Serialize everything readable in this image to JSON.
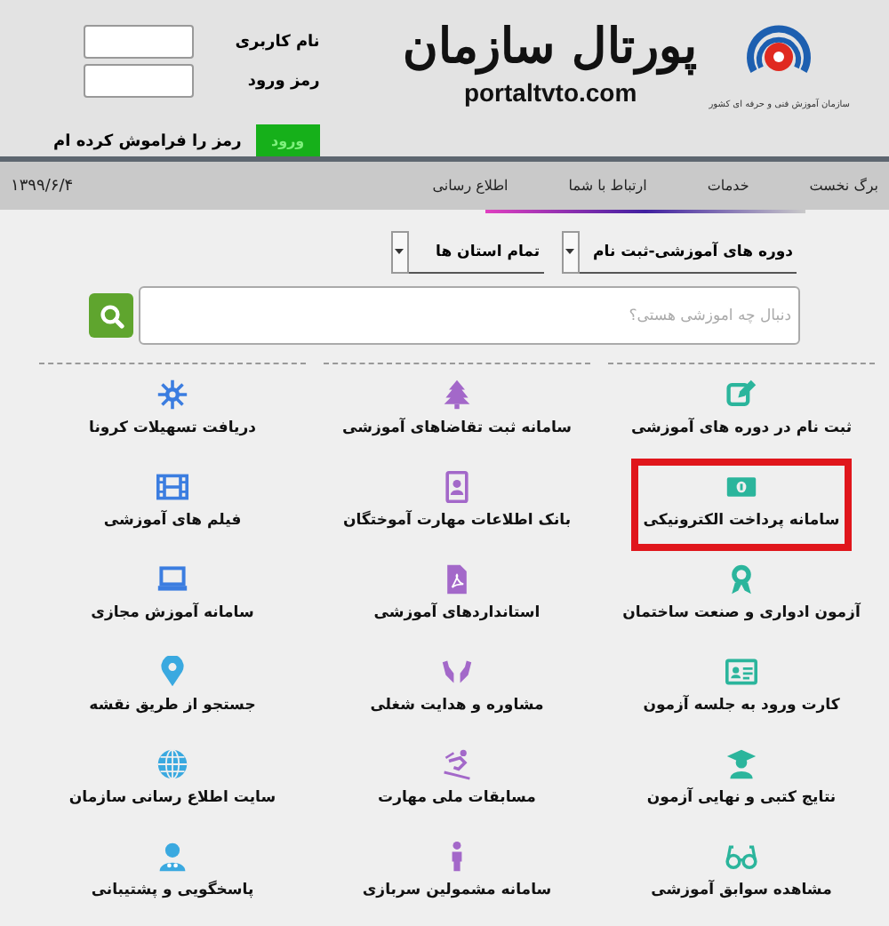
{
  "header": {
    "logo": {
      "title": "پورتال سازمان",
      "domain": "portaltvto.com",
      "tagline": "سازمان آموزش فنی و حرفه ای کشور"
    },
    "login": {
      "username_label": "نام کاربری",
      "password_label": "رمز ورود",
      "submit": "ورود",
      "forgot": "رمز را فراموش کرده ام"
    }
  },
  "nav": {
    "items": [
      {
        "label": "برگ نخست"
      },
      {
        "label": "خدمات"
      },
      {
        "label": "ارتباط با شما"
      },
      {
        "label": "اطلاع رسانی"
      }
    ],
    "date": "۱۳۹۹/۶/۴"
  },
  "search": {
    "dropdowns": [
      {
        "value": "دوره های آموزشی-ثبت نام"
      },
      {
        "value": "تمام استان ها"
      }
    ],
    "placeholder": "دنبال چه آموزشی هستی؟"
  },
  "services": [
    {
      "label": "ثبت نام در دوره های آموزشی",
      "color": "#2bb59c",
      "highlighted": false
    },
    {
      "label": "سامانه ثبت تقاضاهای آموزشی",
      "color": "#a368c9",
      "highlighted": false
    },
    {
      "label": "دریافت تسهیلات کرونا",
      "color": "#3b7de0",
      "highlighted": false
    },
    {
      "label": "سامانه پرداخت الکترونیکی",
      "color": "#2bb59c",
      "highlighted": true
    },
    {
      "label": "بانک اطلاعات مهارت آموختگان",
      "color": "#a368c9",
      "highlighted": false
    },
    {
      "label": "فیلم های آموزشی",
      "color": "#3b7de0",
      "highlighted": false
    },
    {
      "label": "آزمون ادواری و صنعت ساختمان",
      "color": "#2bb59c",
      "highlighted": false
    },
    {
      "label": "استانداردهای آموزشی",
      "color": "#a368c9",
      "highlighted": false
    },
    {
      "label": "سامانه آموزش مجازی",
      "color": "#3b7de0",
      "highlighted": false
    },
    {
      "label": "کارت ورود به جلسه آزمون",
      "color": "#2bb59c",
      "highlighted": false
    },
    {
      "label": "مشاوره و هدایت شغلی",
      "color": "#a368c9",
      "highlighted": false
    },
    {
      "label": "جستجو از طریق نقشه",
      "color": "#3aa9e0",
      "highlighted": false
    },
    {
      "label": "نتایج کتبی و نهایی آزمون",
      "color": "#2bb59c",
      "highlighted": false
    },
    {
      "label": "مسابقات ملی مهارت",
      "color": "#a368c9",
      "highlighted": false
    },
    {
      "label": "سایت اطلاع رسانی سازمان",
      "color": "#3aa9e0",
      "highlighted": false
    },
    {
      "label": "مشاهده سوابق آموزشی",
      "color": "#2bb59c",
      "highlighted": false
    },
    {
      "label": "سامانه مشمولین سربازی",
      "color": "#a368c9",
      "highlighted": false
    },
    {
      "label": "پاسخگویی و پشتیبانی",
      "color": "#3aa9e0",
      "highlighted": false
    }
  ]
}
